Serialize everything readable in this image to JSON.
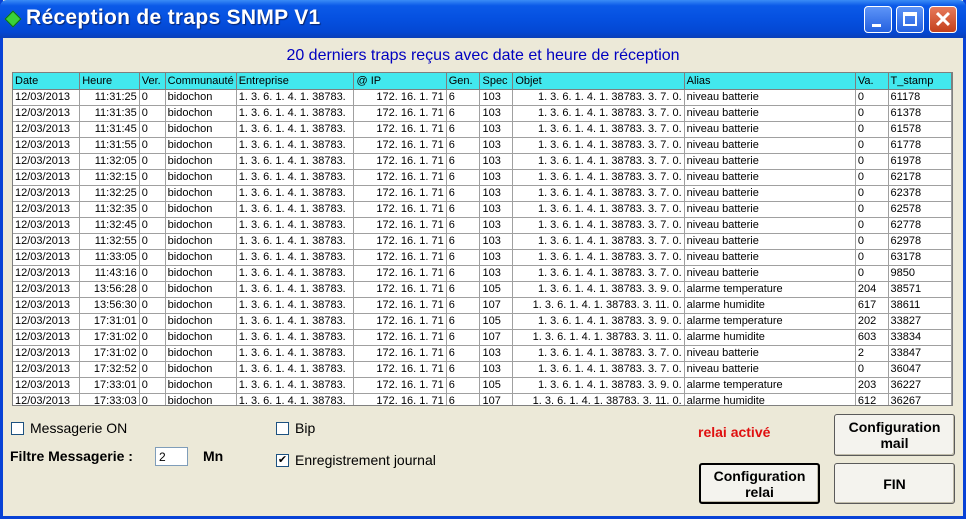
{
  "window": {
    "title": "Réception de traps SNMP V1"
  },
  "subtitle": "20 derniers traps reçus avec date et heure de réception",
  "table": {
    "columns": [
      "Date",
      "Heure",
      "Ver.",
      "Communauté",
      "Entreprise",
      "@ IP",
      "Gen.",
      "Spec",
      "Objet",
      "Alias",
      "Va.",
      "T_stamp"
    ],
    "rows": [
      [
        "12/03/2013",
        "11:31:25",
        "0",
        "bidochon",
        "1. 3. 6. 1. 4. 1. 38783.",
        "172. 16. 1. 71",
        "6",
        "103",
        "1. 3. 6. 1. 4. 1. 38783. 3. 7. 0.",
        "niveau batterie",
        "0",
        "61178"
      ],
      [
        "12/03/2013",
        "11:31:35",
        "0",
        "bidochon",
        "1. 3. 6. 1. 4. 1. 38783.",
        "172. 16. 1. 71",
        "6",
        "103",
        "1. 3. 6. 1. 4. 1. 38783. 3. 7. 0.",
        "niveau batterie",
        "0",
        "61378"
      ],
      [
        "12/03/2013",
        "11:31:45",
        "0",
        "bidochon",
        "1. 3. 6. 1. 4. 1. 38783.",
        "172. 16. 1. 71",
        "6",
        "103",
        "1. 3. 6. 1. 4. 1. 38783. 3. 7. 0.",
        "niveau batterie",
        "0",
        "61578"
      ],
      [
        "12/03/2013",
        "11:31:55",
        "0",
        "bidochon",
        "1. 3. 6. 1. 4. 1. 38783.",
        "172. 16. 1. 71",
        "6",
        "103",
        "1. 3. 6. 1. 4. 1. 38783. 3. 7. 0.",
        "niveau batterie",
        "0",
        "61778"
      ],
      [
        "12/03/2013",
        "11:32:05",
        "0",
        "bidochon",
        "1. 3. 6. 1. 4. 1. 38783.",
        "172. 16. 1. 71",
        "6",
        "103",
        "1. 3. 6. 1. 4. 1. 38783. 3. 7. 0.",
        "niveau batterie",
        "0",
        "61978"
      ],
      [
        "12/03/2013",
        "11:32:15",
        "0",
        "bidochon",
        "1. 3. 6. 1. 4. 1. 38783.",
        "172. 16. 1. 71",
        "6",
        "103",
        "1. 3. 6. 1. 4. 1. 38783. 3. 7. 0.",
        "niveau batterie",
        "0",
        "62178"
      ],
      [
        "12/03/2013",
        "11:32:25",
        "0",
        "bidochon",
        "1. 3. 6. 1. 4. 1. 38783.",
        "172. 16. 1. 71",
        "6",
        "103",
        "1. 3. 6. 1. 4. 1. 38783. 3. 7. 0.",
        "niveau batterie",
        "0",
        "62378"
      ],
      [
        "12/03/2013",
        "11:32:35",
        "0",
        "bidochon",
        "1. 3. 6. 1. 4. 1. 38783.",
        "172. 16. 1. 71",
        "6",
        "103",
        "1. 3. 6. 1. 4. 1. 38783. 3. 7. 0.",
        "niveau batterie",
        "0",
        "62578"
      ],
      [
        "12/03/2013",
        "11:32:45",
        "0",
        "bidochon",
        "1. 3. 6. 1. 4. 1. 38783.",
        "172. 16. 1. 71",
        "6",
        "103",
        "1. 3. 6. 1. 4. 1. 38783. 3. 7. 0.",
        "niveau batterie",
        "0",
        "62778"
      ],
      [
        "12/03/2013",
        "11:32:55",
        "0",
        "bidochon",
        "1. 3. 6. 1. 4. 1. 38783.",
        "172. 16. 1. 71",
        "6",
        "103",
        "1. 3. 6. 1. 4. 1. 38783. 3. 7. 0.",
        "niveau batterie",
        "0",
        "62978"
      ],
      [
        "12/03/2013",
        "11:33:05",
        "0",
        "bidochon",
        "1. 3. 6. 1. 4. 1. 38783.",
        "172. 16. 1. 71",
        "6",
        "103",
        "1. 3. 6. 1. 4. 1. 38783. 3. 7. 0.",
        "niveau batterie",
        "0",
        "63178"
      ],
      [
        "12/03/2013",
        "11:43:16",
        "0",
        "bidochon",
        "1. 3. 6. 1. 4. 1. 38783.",
        "172. 16. 1. 71",
        "6",
        "103",
        "1. 3. 6. 1. 4. 1. 38783. 3. 7. 0.",
        "niveau batterie",
        "0",
        "9850"
      ],
      [
        "12/03/2013",
        "13:56:28",
        "0",
        "bidochon",
        "1. 3. 6. 1. 4. 1. 38783.",
        "172. 16. 1. 71",
        "6",
        "105",
        "1. 3. 6. 1. 4. 1. 38783. 3. 9. 0.",
        "alarme temperature",
        "204",
        "38571"
      ],
      [
        "12/03/2013",
        "13:56:30",
        "0",
        "bidochon",
        "1. 3. 6. 1. 4. 1. 38783.",
        "172. 16. 1. 71",
        "6",
        "107",
        "1. 3. 6. 1. 4. 1. 38783. 3. 11. 0.",
        "alarme humidite",
        "617",
        "38611"
      ],
      [
        "12/03/2013",
        "17:31:01",
        "0",
        "bidochon",
        "1. 3. 6. 1. 4. 1. 38783.",
        "172. 16. 1. 71",
        "6",
        "105",
        "1. 3. 6. 1. 4. 1. 38783. 3. 9. 0.",
        "alarme temperature",
        "202",
        "33827"
      ],
      [
        "12/03/2013",
        "17:31:02",
        "0",
        "bidochon",
        "1. 3. 6. 1. 4. 1. 38783.",
        "172. 16. 1. 71",
        "6",
        "107",
        "1. 3. 6. 1. 4. 1. 38783. 3. 11. 0.",
        "alarme humidite",
        "603",
        "33834"
      ],
      [
        "12/03/2013",
        "17:31:02",
        "0",
        "bidochon",
        "1. 3. 6. 1. 4. 1. 38783.",
        "172. 16. 1. 71",
        "6",
        "103",
        "1. 3. 6. 1. 4. 1. 38783. 3. 7. 0.",
        "niveau batterie",
        "2",
        "33847"
      ],
      [
        "12/03/2013",
        "17:32:52",
        "0",
        "bidochon",
        "1. 3. 6. 1. 4. 1. 38783.",
        "172. 16. 1. 71",
        "6",
        "103",
        "1. 3. 6. 1. 4. 1. 38783. 3. 7. 0.",
        "niveau batterie",
        "0",
        "36047"
      ],
      [
        "12/03/2013",
        "17:33:01",
        "0",
        "bidochon",
        "1. 3. 6. 1. 4. 1. 38783.",
        "172. 16. 1. 71",
        "6",
        "105",
        "1. 3. 6. 1. 4. 1. 38783. 3. 9. 0.",
        "alarme temperature",
        "203",
        "36227"
      ],
      [
        "12/03/2013",
        "17:33:03",
        "0",
        "bidochon",
        "1. 3. 6. 1. 4. 1. 38783.",
        "172. 16. 1. 71",
        "6",
        "107",
        "1. 3. 6. 1. 4. 1. 38783. 3. 11. 0.",
        "alarme humidite",
        "612",
        "36267"
      ]
    ]
  },
  "controls": {
    "messagerie_on_label": "Messagerie ON",
    "messagerie_on_checked": false,
    "bip_label": "Bip",
    "bip_checked": false,
    "journal_label": "Enregistrement journal",
    "journal_checked": true,
    "filtre_label": "Filtre Messagerie :",
    "filtre_value": "2",
    "filtre_unit": "Mn",
    "relai_status": "relai activé"
  },
  "buttons": {
    "config_mail": "Configuration\nmail",
    "config_relai": "Configuration\nrelai",
    "fin": "FIN"
  },
  "colors": {
    "header_bg": "#42e8ee",
    "subtitle": "#0000c0",
    "relai_status": "#e01010"
  }
}
